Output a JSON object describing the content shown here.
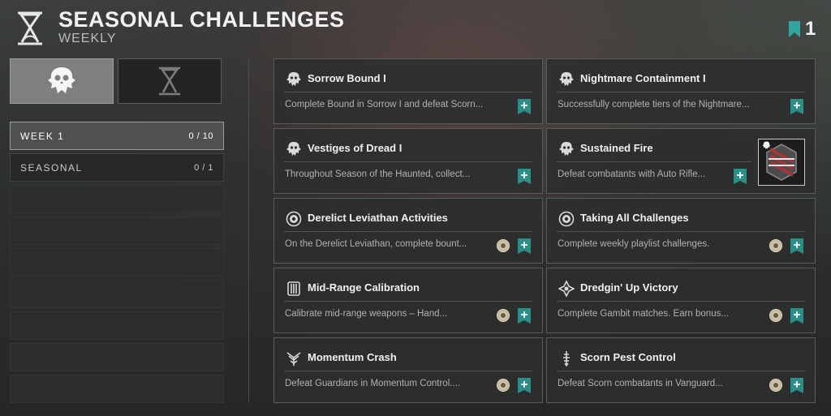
{
  "header": {
    "title": "SEASONAL CHALLENGES",
    "subtitle": "WEEKLY",
    "bookmark_count": "1",
    "accent_color": "#2fa6a0"
  },
  "tabs": [
    {
      "icon": "skull-emblem-icon",
      "active": true
    },
    {
      "icon": "hourglass-icon",
      "active": false
    }
  ],
  "weeks": [
    {
      "label": "WEEK 1",
      "count": "0 / 10",
      "active": true
    },
    {
      "label": "SEASONAL",
      "count": "0 / 1",
      "active": false
    }
  ],
  "challenges": [
    {
      "name": "Sorrow Bound I",
      "desc": "Complete Bound in Sorrow I and defeat Scorn...",
      "icon": "skull-emblem-icon",
      "coin": false,
      "image": false
    },
    {
      "name": "Nightmare Containment I",
      "desc": "Successfully complete tiers of the Nightmare...",
      "icon": "skull-emblem-icon",
      "coin": false,
      "image": false
    },
    {
      "name": "Vestiges of Dread I",
      "desc": "Throughout Season of the Haunted, collect...",
      "icon": "skull-emblem-icon",
      "coin": false,
      "image": false
    },
    {
      "name": "Sustained Fire",
      "desc": "Defeat combatants with Auto Rifle...",
      "icon": "skull-emblem-icon",
      "coin": false,
      "image": true
    },
    {
      "name": "Derelict Leviathan Activities",
      "desc": "On the Derelict Leviathan, complete bount...",
      "icon": "ring-emblem-icon",
      "coin": true,
      "image": false
    },
    {
      "name": "Taking All Challenges",
      "desc": "Complete weekly playlist challenges.",
      "icon": "ring-emblem-icon",
      "coin": true,
      "image": false
    },
    {
      "name": "Mid-Range Calibration",
      "desc": "Calibrate mid-range weapons – Hand...",
      "icon": "shield-emblem-icon",
      "coin": true,
      "image": false
    },
    {
      "name": "Dredgin' Up Victory",
      "desc": "Complete Gambit matches. Earn bonus...",
      "icon": "gambit-emblem-icon",
      "coin": true,
      "image": false
    },
    {
      "name": "Momentum Crash",
      "desc": "Defeat Guardians in Momentum Control....",
      "icon": "crucible-emblem-icon",
      "coin": true,
      "image": false
    },
    {
      "name": "Scorn Pest Control",
      "desc": "Defeat Scorn combatants in Vanguard...",
      "icon": "vanguard-emblem-icon",
      "coin": true,
      "image": false
    }
  ]
}
